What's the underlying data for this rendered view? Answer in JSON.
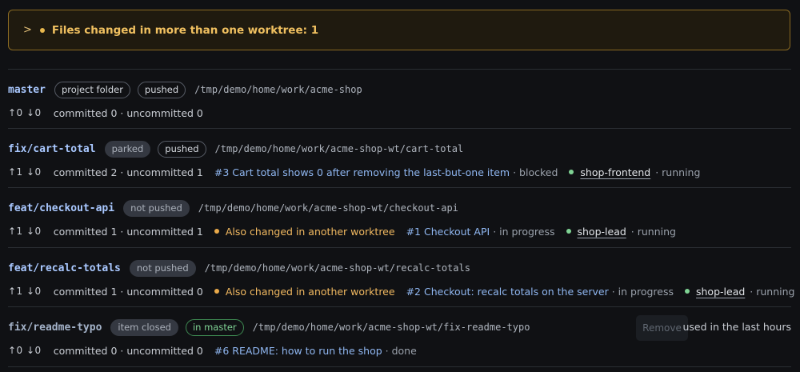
{
  "banner": {
    "text": "Files changed in more than one worktree: 1"
  },
  "worktrees": [
    {
      "branch": "master",
      "tags": [
        "project folder",
        "pushed"
      ],
      "path": "/tmp/demo/home/work/acme-shop",
      "arrows": "↑0 ↓0",
      "counts": "committed 0 · uncommitted 0"
    },
    {
      "branch": "fix/cart-total",
      "tags": [
        "parked",
        "pushed"
      ],
      "path": "/tmp/demo/home/work/acme-shop-wt/cart-total",
      "arrows": "↑1 ↓0",
      "counts": "committed 2 · uncommitted 1",
      "issue": "#3 Cart total shows 0 after removing the last-but-one item",
      "issue_status": "· blocked",
      "agent": "shop-frontend",
      "agent_status": "· running"
    },
    {
      "branch": "feat/checkout-api",
      "tags": [
        "not pushed"
      ],
      "path": "/tmp/demo/home/work/acme-shop-wt/checkout-api",
      "arrows": "↑1 ↓0",
      "counts": "committed 1 · uncommitted 1",
      "warning": "Also changed in another worktree",
      "issue": "#1 Checkout API",
      "issue_status": "· in progress",
      "agent": "shop-lead",
      "agent_status": "· running"
    },
    {
      "branch": "feat/recalc-totals",
      "tags": [
        "not pushed"
      ],
      "path": "/tmp/demo/home/work/acme-shop-wt/recalc-totals",
      "arrows": "↑1 ↓0",
      "counts": "committed 1 · uncommitted 0",
      "warning": "Also changed in another worktree",
      "issue": "#2 Checkout: recalc totals on the server",
      "issue_status": "· in progress",
      "agent": "shop-lead",
      "agent_status": "· running"
    },
    {
      "branch": "fix/readme-typo",
      "tags": [
        "item closed",
        "in master"
      ],
      "path": "/tmp/demo/home/work/acme-shop-wt/fix-readme-typo",
      "arrows": "↑0 ↓0",
      "counts": "committed 0 · uncommitted 0",
      "issue": "#6 README: how to run the shop",
      "issue_status": "· done",
      "remove_label": "Remove",
      "used_note": "used in the last hours"
    }
  ]
}
